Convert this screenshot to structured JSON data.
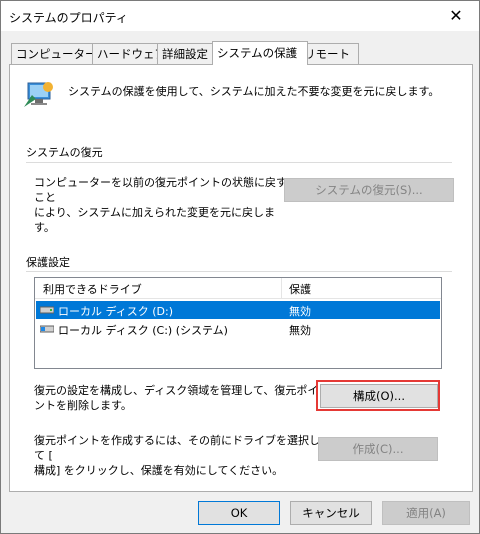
{
  "window": {
    "title": "システムのプロパティ",
    "close_glyph": "✕"
  },
  "tabs": [
    {
      "label": "コンピューター名"
    },
    {
      "label": "ハードウェア"
    },
    {
      "label": "詳細設定"
    },
    {
      "label": "システムの保護"
    },
    {
      "label": "リモート"
    }
  ],
  "intro": {
    "text": "システムの保護を使用して、システムに加えた不要な変更を元に戻します。",
    "icon": "system-protection-icon"
  },
  "restore": {
    "title": "システムの復元",
    "line1": "コンピューターを以前の復元ポイントの状態に戻すこと",
    "line2": "により、システムに加えられた変更を元に戻します。",
    "button": "システムの復元(S)..."
  },
  "protection": {
    "title": "保護設定",
    "columns": {
      "drive": "利用できるドライブ",
      "protection": "保護"
    },
    "drives": [
      {
        "name": "ローカル ディスク (D:)",
        "status": "無効",
        "selected": true
      },
      {
        "name": "ローカル ディスク (C:) (システム)",
        "status": "無効",
        "selected": false
      }
    ],
    "configure_line1": "復元の設定を構成し、ディスク領域を管理して、復元ポイ",
    "configure_line2": "ントを削除します。",
    "configure_button": "構成(O)...",
    "create_line1": "復元ポイントを作成するには、その前にドライブを選択して [",
    "create_line2": "構成] をクリックし、保護を有効にしてください。",
    "create_button": "作成(C)..."
  },
  "footer": {
    "ok": "OK",
    "cancel": "キャンセル",
    "apply": "適用(A)"
  },
  "colors": {
    "selection": "#0078d7",
    "highlight": "#e53935"
  }
}
